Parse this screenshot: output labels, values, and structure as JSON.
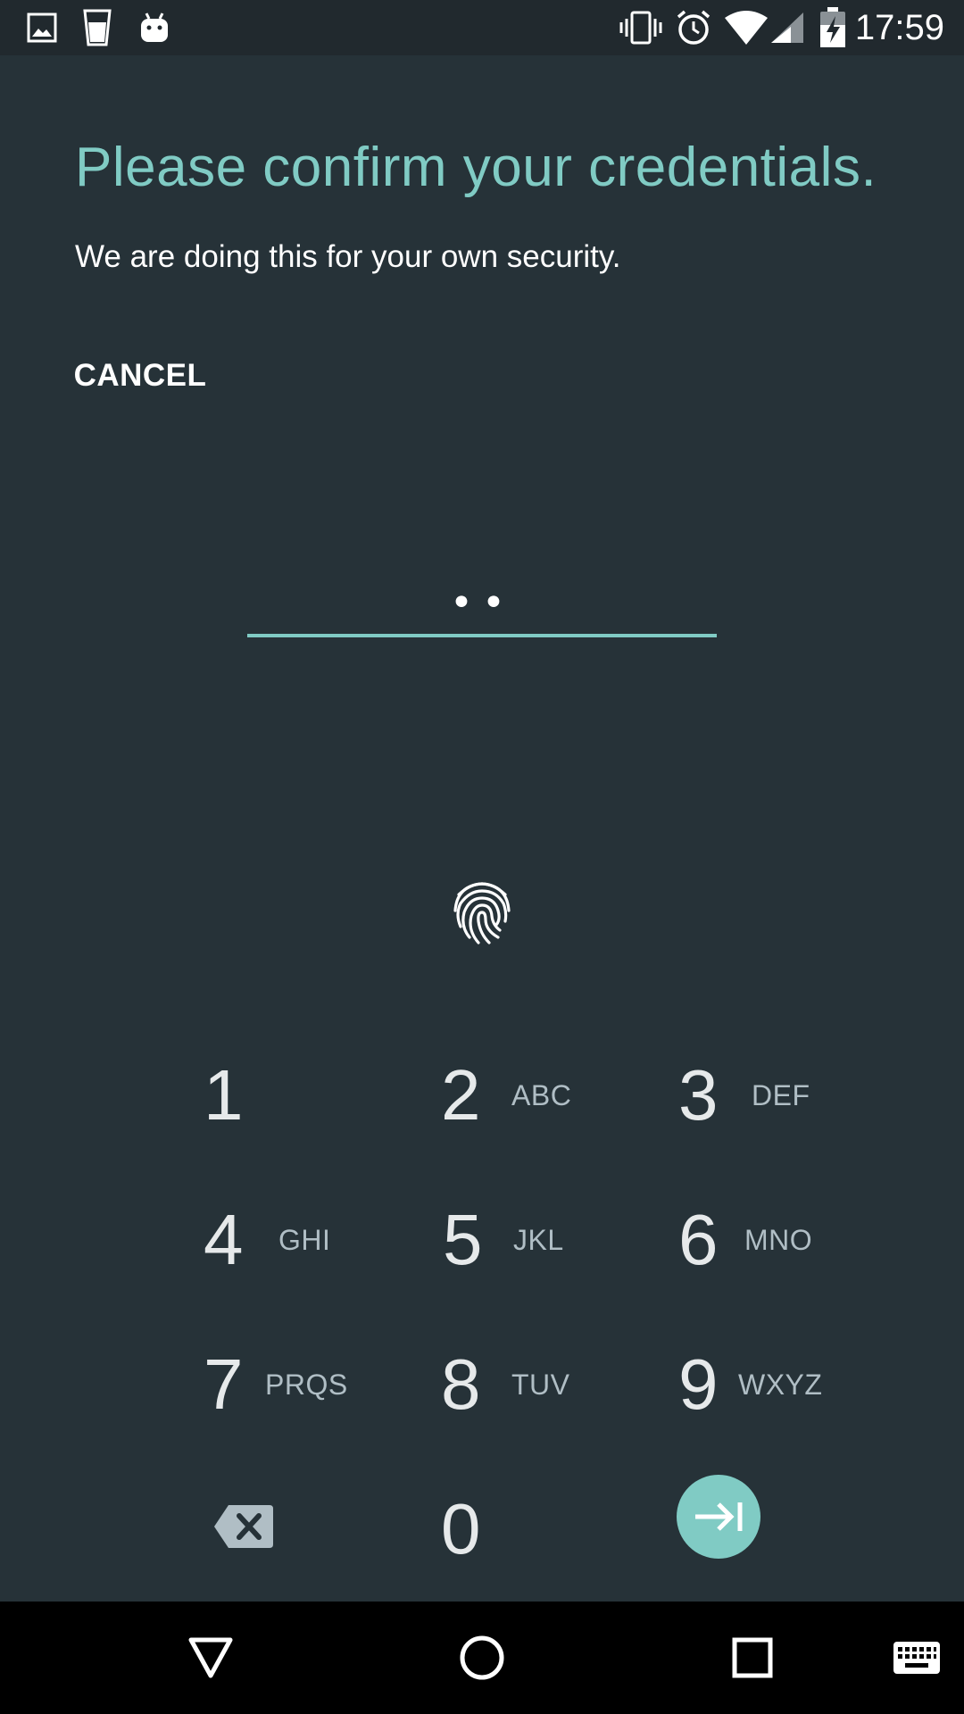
{
  "status_bar": {
    "time": "17:59",
    "left_icons": [
      "image-icon",
      "drink-cup-icon",
      "android-icon"
    ],
    "right_icons": [
      "vibrate-icon",
      "alarm-icon",
      "wifi-icon",
      "cell-signal-icon",
      "battery-charging-icon"
    ]
  },
  "header": {
    "title": "Please confirm your credentials.",
    "subtitle": "We are doing this for your own security."
  },
  "cancel_label": "CANCEL",
  "pin": {
    "masked_value": "••"
  },
  "fingerprint_icon": "fingerprint-icon",
  "keypad": {
    "keys": [
      {
        "digit": "1",
        "letters": ""
      },
      {
        "digit": "2",
        "letters": "ABC"
      },
      {
        "digit": "3",
        "letters": "DEF"
      },
      {
        "digit": "4",
        "letters": "GHI"
      },
      {
        "digit": "5",
        "letters": "JKL"
      },
      {
        "digit": "6",
        "letters": "MNO"
      },
      {
        "digit": "7",
        "letters": "PRQS"
      },
      {
        "digit": "8",
        "letters": "TUV"
      },
      {
        "digit": "9",
        "letters": "WXYZ"
      },
      {
        "digit": "0",
        "letters": ""
      }
    ],
    "delete_icon": "backspace-icon",
    "enter_icon": "enter-arrow-icon"
  },
  "nav_bar": {
    "buttons": [
      "back-icon",
      "home-icon",
      "recents-icon",
      "keyboard-icon"
    ]
  },
  "colors": {
    "accent": "#80cbc4",
    "background": "#263238",
    "status_bar": "#21292e",
    "nav_bar": "#000000"
  }
}
